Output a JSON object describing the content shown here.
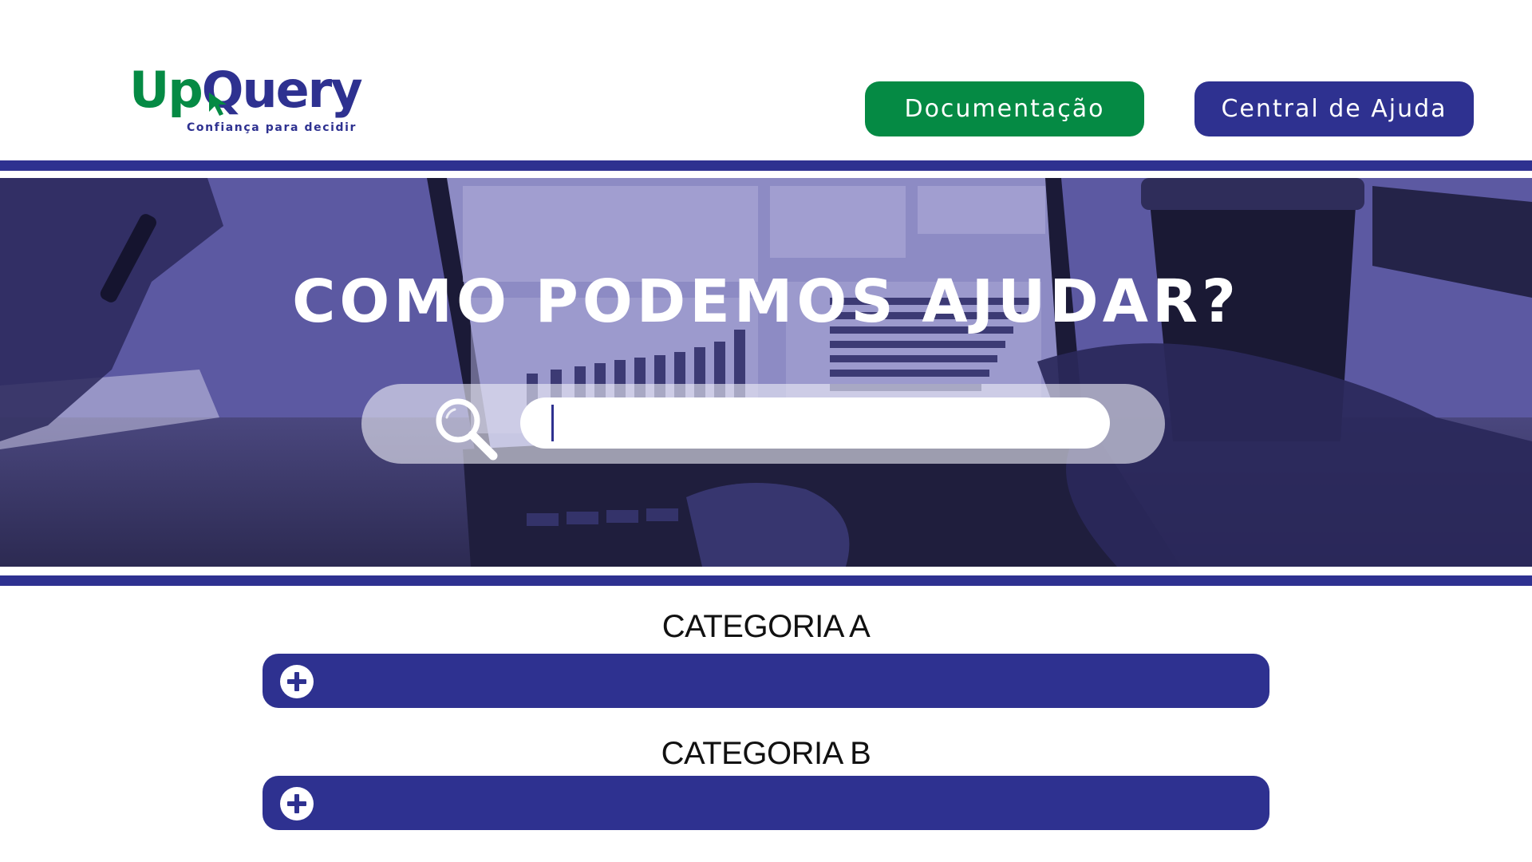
{
  "header": {
    "logo": {
      "part1": "Up",
      "part2": "Query",
      "tagline": "Confiança para decidir",
      "icon": "cursor-arrow-icon"
    },
    "buttons": {
      "docs_label": "Documentação",
      "help_label": "Central de Ajuda"
    }
  },
  "hero": {
    "title": "COMO PODEMOS AJUDAR?",
    "search": {
      "value": "",
      "placeholder": "",
      "icon": "search-icon"
    }
  },
  "categories": [
    {
      "title": "CATEGORIA A",
      "icon": "plus-circle-icon"
    },
    {
      "title": "CATEGORIA B",
      "icon": "plus-circle-icon"
    }
  ],
  "colors": {
    "primary": "#2e3190",
    "green": "#058a44",
    "hero_tint": "#5f5ca6",
    "white": "#ffffff"
  }
}
